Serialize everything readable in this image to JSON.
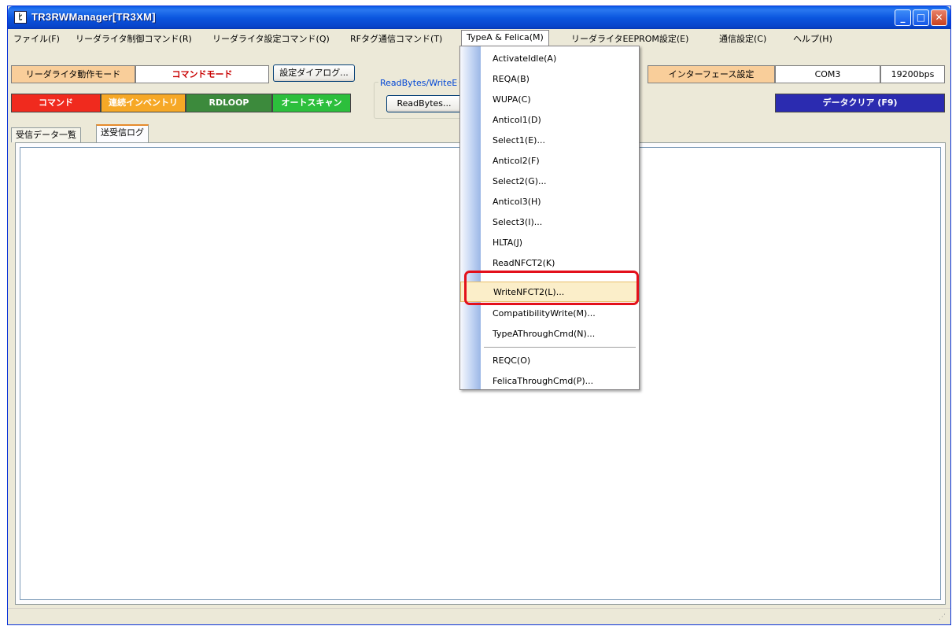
{
  "window": {
    "title": "TR3RWManager[TR3XM]",
    "icon_glyph": "ﾋ",
    "minimize_glyph": "_",
    "maximize_glyph": "□",
    "close_glyph": "✕"
  },
  "menubar": {
    "items": [
      "ファイル(F)",
      "リーダライタ制御コマンド(R)",
      "リーダライタ設定コマンド(Q)",
      "RFタグ通信コマンド(T)",
      "TypeA & Felica(M)",
      "リーダライタEEPROM設定(E)",
      "通信設定(C)",
      "ヘルプ(H)"
    ]
  },
  "toolbar": {
    "mode_label": "リーダライタ動作モード",
    "mode_value": "コマンドモード",
    "settings_dialog": "設定ダイアログ...",
    "group_label": "ReadBytes/WriteE",
    "read_bytes": "ReadBytes...",
    "interface_label": "インターフェース設定",
    "com_port": "COM3",
    "baud_rate": "19200bps",
    "cmd_command": "コマンド",
    "cmd_inventory": "連続インベントリ",
    "cmd_rdloop": "RDLOOP",
    "cmd_autoscan": "オートスキャン",
    "data_clear": "データクリア (F9)"
  },
  "tabs": [
    "受信データ一覧",
    "送受信ログ"
  ],
  "dropdown": {
    "items": [
      "ActivateIdle(A)",
      "REQA(B)",
      "WUPA(C)",
      "Anticol1(D)",
      "Select1(E)...",
      "Anticol2(F)",
      "Select2(G)...",
      "Anticol3(H)",
      "Select3(I)...",
      "HLTA(J)",
      "ReadNFCT2(K)",
      "WriteNFCT2(L)...",
      "CompatibilityWrite(M)...",
      "TypeAThroughCmd(N)...",
      "REQC(O)",
      "FelicaThroughCmd(P)..."
    ],
    "highlighted": "WriteNFCT2(L)..."
  },
  "colors": {
    "cmd_command": "#f02a1e",
    "cmd_inventory": "#f6a826",
    "cmd_rdloop": "#3c8a3c",
    "cmd_autoscan": "#2cbf3c",
    "data_clear": "#2b2bb0",
    "mode_value_text": "#c80000",
    "annotation": "#e3101b"
  },
  "icons": {
    "app": "app-window-icon",
    "resize": "resize-grip-icon"
  }
}
